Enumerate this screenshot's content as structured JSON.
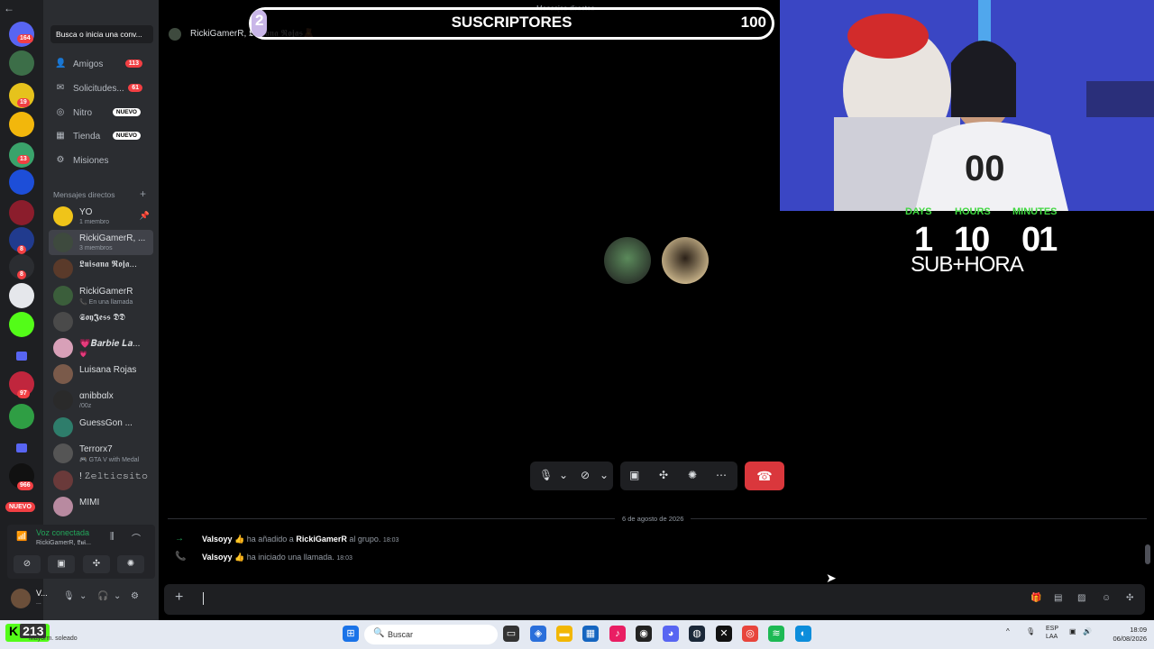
{
  "sidebar": {
    "search_label": "Busca o inicia una conv...",
    "nav": [
      {
        "label": "Amigos",
        "badge": "113"
      },
      {
        "label": "Solicitudes...",
        "badge": "61"
      },
      {
        "label": "Nitro",
        "tag": "NUEVO"
      },
      {
        "label": "Tienda",
        "tag": "NUEVO"
      },
      {
        "label": "Misiones"
      }
    ],
    "dm_header": "Mensajes directos",
    "dms": [
      {
        "name": "YO",
        "sub": "1 miembro"
      },
      {
        "name": "RickiGamerR, ...",
        "sub": "3 miembros"
      },
      {
        "name": "𝕷𝖚𝖎𝖘𝖆𝖓𝖆 𝕽𝖔𝖏𝖆...",
        "sub": ""
      },
      {
        "name": "RickiGamerR",
        "sub": "📞 En una llamada"
      },
      {
        "name": "𝕾𝖔𝖞𝕵𝖊𝖘𝖘 𝕯𝕯",
        "sub": ""
      },
      {
        "name": "💗𝑩𝒂𝒓𝒃𝒊𝒆 𝑳𝒂...",
        "sub": "💗"
      },
      {
        "name": "Luisana Rojas",
        "sub": ""
      },
      {
        "name": "αnibbαlx",
        "sub": "/00z"
      },
      {
        "name": "GuessGon ...",
        "sub": ""
      },
      {
        "name": "Terrorx7",
        "sub": "🎮 GTA V with Medal"
      },
      {
        "name": "! 𝚉𝚎𝚕𝚝𝚒𝚌𝚜𝚒𝚝𝚘",
        "sub": ""
      },
      {
        "name": "MIMI",
        "sub": ""
      }
    ],
    "server_badges": [
      "164",
      "19",
      "13",
      "8",
      "8",
      "97",
      "966"
    ],
    "new_pill": "NUEVO",
    "voice_status": "Voz conectada",
    "voice_sub": "RickiGamerR, 𝕷𝖚𝖎...",
    "user_name": "V...",
    "user_status": "..."
  },
  "header": {
    "title": "RickiGamerR, 𝕷𝖚𝖎𝖘𝖆𝖓𝖆 𝕽𝖔𝖏𝖆𝖘🧸",
    "mini": "Mensajes directos"
  },
  "overlay": {
    "current": "2",
    "label": "SUSCRIPTORES",
    "goal": "100",
    "progress": 0.02,
    "timer": {
      "days_label": "DAYS",
      "hours_label": "HOURS",
      "minutes_label": "MINUTES",
      "days": "1",
      "hours": "10",
      "minutes": "01"
    },
    "subhora": "SUB+HORA"
  },
  "chat": {
    "date": "6 de agosto de 2026",
    "messages": [
      {
        "author": "Valsoyy 👍",
        "action": "ha añadido a",
        "target": "RickiGamerR",
        "tail": "al grupo.",
        "time": "18:03"
      },
      {
        "author": "Valsoyy 👍",
        "action": "ha iniciado una llamada.",
        "target": "",
        "tail": "",
        "time": "18:03"
      }
    ]
  },
  "taskbar": {
    "kick_count": "213",
    "weather": "Mayorm. soleado",
    "search": "Buscar",
    "lang": "ESP",
    "lang2": "LAA",
    "time": "18:09",
    "date": "06/08/2026"
  },
  "colors": {
    "accent": "#5865f2",
    "green": "#23a55a",
    "red": "#da373c"
  }
}
